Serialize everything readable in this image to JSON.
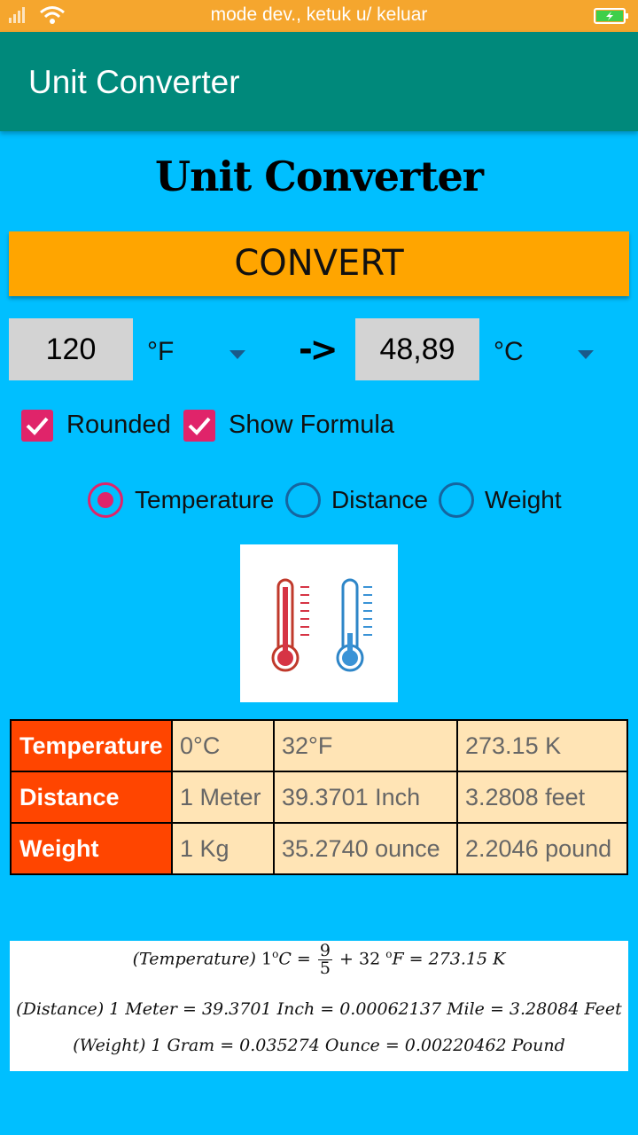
{
  "status_bar": {
    "text": "mode dev., ketuk u/ keluar"
  },
  "app_bar": {
    "title": "Unit Converter"
  },
  "heading": "Unit Converter",
  "convert_label": "CONVERT",
  "converter": {
    "input_value": "120",
    "input_unit": "°F",
    "arrow": "->",
    "output_value": "48,89",
    "output_unit": "°C"
  },
  "options": {
    "rounded_label": "Rounded",
    "rounded_checked": true,
    "formula_label": "Show Formula",
    "formula_checked": true
  },
  "categories": {
    "selected": "Temperature",
    "items": [
      "Temperature",
      "Distance",
      "Weight"
    ]
  },
  "reference_table": {
    "rows": [
      {
        "label": "Temperature",
        "values": [
          "0°C",
          "32°F",
          "273.15 K"
        ]
      },
      {
        "label": "Distance",
        "values": [
          "1 Meter",
          "39.3701 Inch",
          "3.2808 feet"
        ]
      },
      {
        "label": "Weight",
        "values": [
          "1 Kg",
          "35.2740 ounce",
          "2.2046 pound"
        ]
      }
    ]
  },
  "formulas": {
    "temperature": {
      "prefix": "(Temperature)",
      "lhs": "1",
      "unit_c": "C",
      "frac_num": "9",
      "frac_den": "5",
      "rest": "+ 32 ",
      "unit_f": "F",
      "tail": "= 273.15 K"
    },
    "distance": "(Distance) 1 Meter = 39.3701 Inch = 0.00062137 Mile =  3.28084 Feet",
    "weight": "(Weight) 1 Gram = 0.035274 Ounce = 0.00220462 Pound"
  },
  "colors": {
    "background": "#00bfff",
    "status_bar": "#f5a62e",
    "app_bar": "#00897b",
    "convert_button": "#ffa500",
    "accent": "#e0246a",
    "table_header": "#ff4500",
    "table_cell": "#ffe4b5"
  },
  "icons": {
    "signal": "signal-icon",
    "wifi": "wifi-icon",
    "battery": "battery-charging-icon",
    "dropdown": "chevron-down-icon",
    "thermometers": "thermometer-hot-cold-icon"
  }
}
